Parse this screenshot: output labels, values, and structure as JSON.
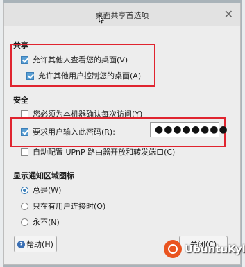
{
  "window": {
    "title": "桌面共享首选项"
  },
  "sharing": {
    "heading": "共享",
    "allow_view": {
      "label": "允许其他人查看您的桌面(V)",
      "checked": true
    },
    "allow_control": {
      "label": "允许其他用户控制您的桌面(A)",
      "checked": true
    }
  },
  "security": {
    "heading": "安全",
    "confirm_access": {
      "label": "您必须为本机器确认每次访问(Y)",
      "checked": false
    },
    "require_password": {
      "label": "要求用户输入此密码(R):",
      "checked": true
    },
    "password_value": "●●●●●●●●",
    "upnp": {
      "label": "自动配置 UPnP 路由器开放和转发端口(C)",
      "checked": false
    }
  },
  "notification": {
    "heading": "显示通知区域图标",
    "options": [
      {
        "label": "总是(W)",
        "selected": true
      },
      {
        "label": "只在有用户连接时(O)",
        "selected": false
      },
      {
        "label": "永不(N)",
        "selected": false
      }
    ]
  },
  "buttons": {
    "help": "帮助(H)",
    "close": "关闭(C)"
  },
  "watermark": {
    "text": "UbuntuKylin"
  },
  "colors": {
    "highlight": "#e0242f",
    "accent": "#3c7fb8",
    "brand": "#e95420"
  }
}
